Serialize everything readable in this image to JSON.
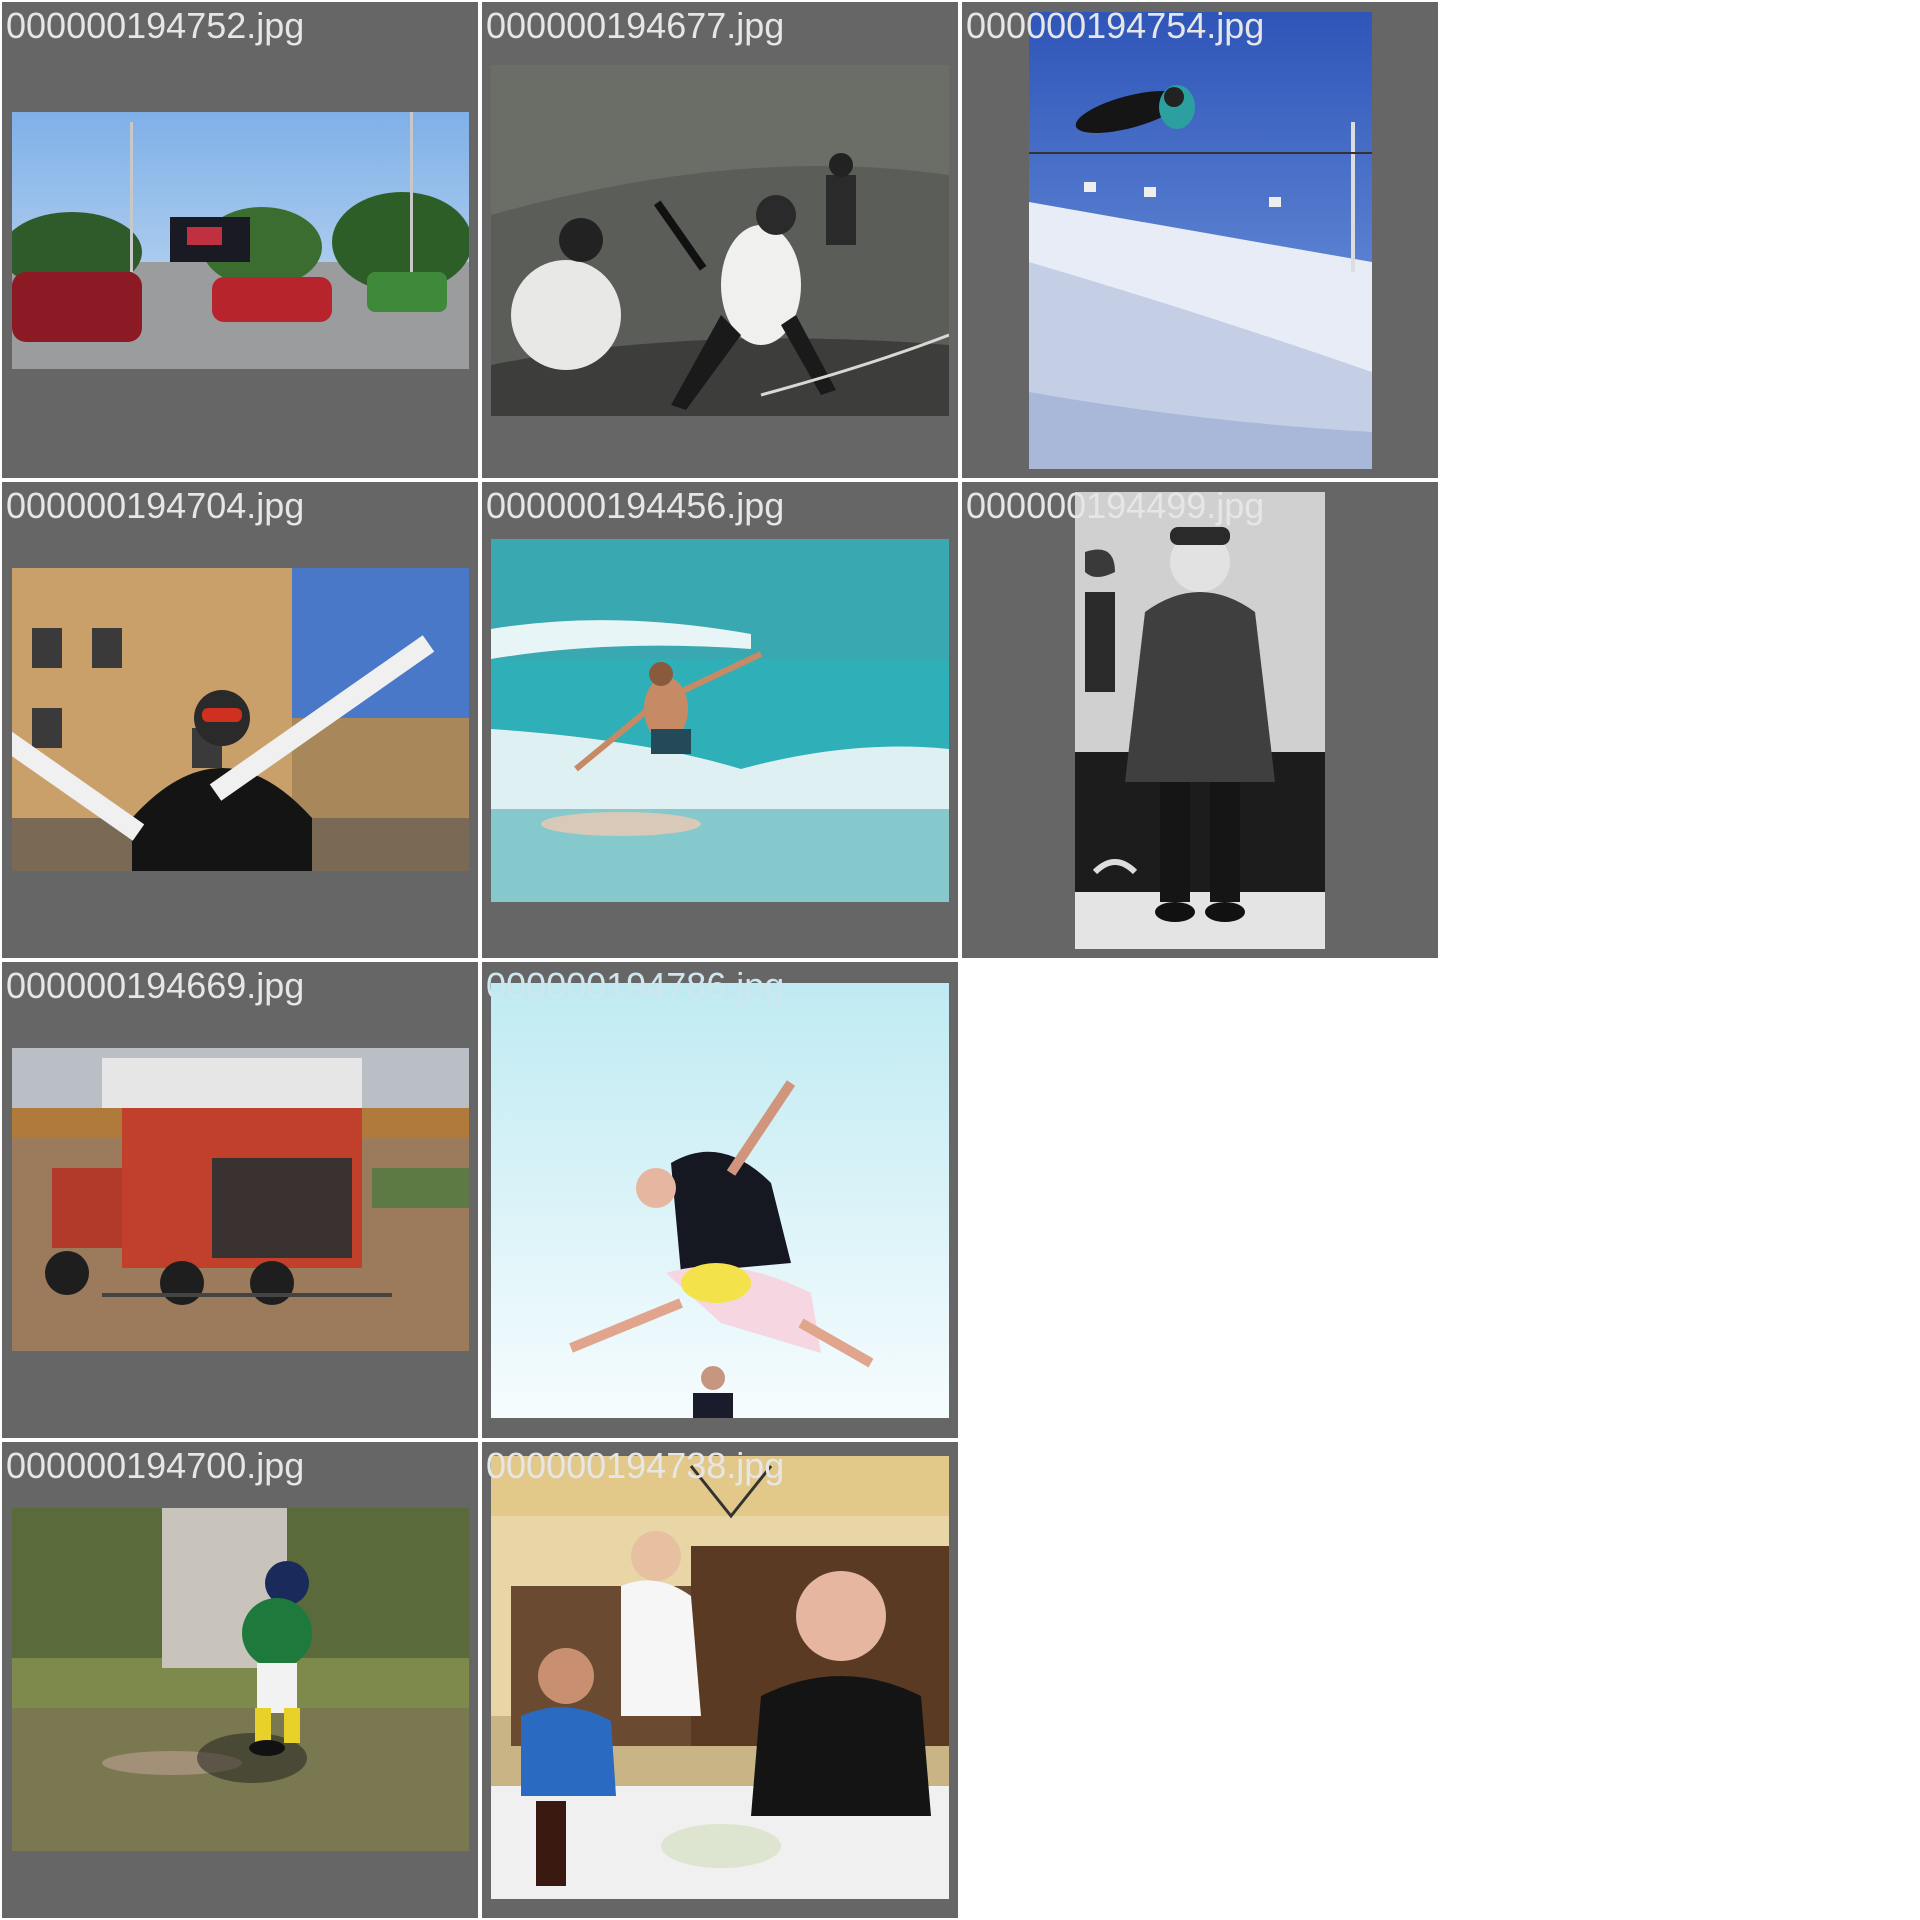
{
  "gallery": {
    "tiles": [
      {
        "filename": "000000194752.jpg"
      },
      {
        "filename": "000000194677.jpg"
      },
      {
        "filename": "000000194754.jpg"
      },
      {
        "filename": "000000194704.jpg"
      },
      {
        "filename": "000000194456.jpg"
      },
      {
        "filename": "000000194499.jpg"
      },
      {
        "filename": "000000194669.jpg"
      },
      {
        "filename": "000000194786.jpg"
      },
      {
        "filename": "000000194700.jpg"
      },
      {
        "filename": "000000194738.jpg"
      }
    ]
  }
}
